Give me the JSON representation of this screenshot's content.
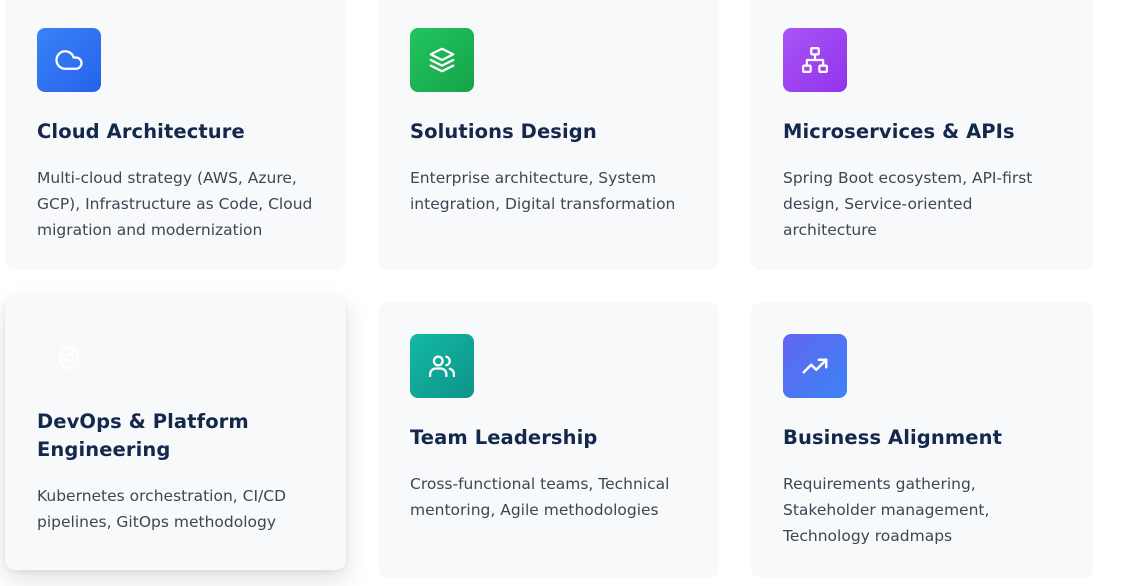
{
  "colors": {
    "card_bg": "#f8f9fb",
    "title": "#14284b",
    "text": "#3e4653"
  },
  "cards": [
    {
      "title": "Cloud Architecture",
      "description": "Multi-cloud strategy (AWS, Azure, GCP), Infrastructure as Code, Cloud migration and modernization",
      "icon": "cloud-icon",
      "gradient": [
        "#3b82f6",
        "#2563eb"
      ]
    },
    {
      "title": "Solutions Design",
      "description": "Enterprise architecture, System integration, Digital transformation",
      "icon": "layers-icon",
      "gradient": [
        "#22c55e",
        "#16a34a"
      ]
    },
    {
      "title": "Microservices & APIs",
      "description": "Spring Boot ecosystem, API-first design, Service-oriented architecture",
      "icon": "network-icon",
      "gradient": [
        "#a855f7",
        "#9333ea"
      ]
    },
    {
      "title": "DevOps & Platform Engineering",
      "description": "Kubernetes orchestration, CI/CD pipelines, GitOps methodology",
      "icon": "gear-icon",
      "gradient": [
        "#f8f9fb",
        "#f8f9fb"
      ]
    },
    {
      "title": "Team Leadership",
      "description": "Cross-functional teams, Technical mentoring, Agile methodologies",
      "icon": "users-icon",
      "gradient": [
        "#14b8a6",
        "#0d9488"
      ]
    },
    {
      "title": "Business Alignment",
      "description": "Requirements gathering, Stakeholder management, Technology roadmaps",
      "icon": "trending-up-icon",
      "gradient": [
        "#6366f1",
        "#3b82f6"
      ]
    }
  ]
}
